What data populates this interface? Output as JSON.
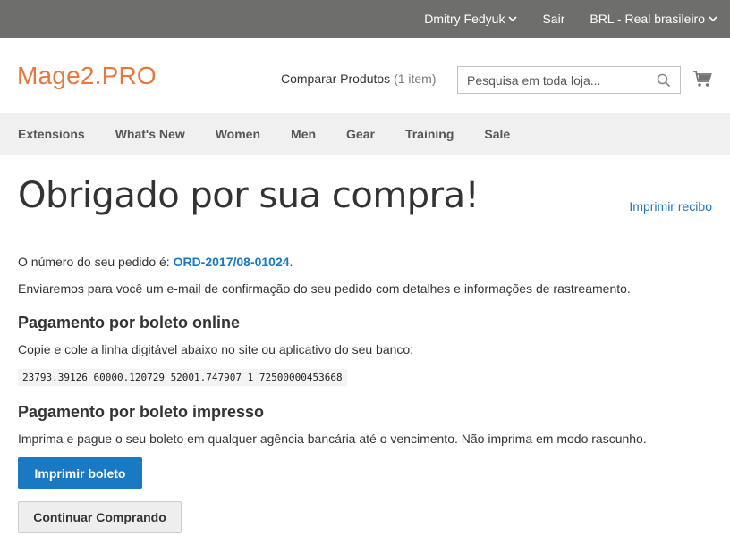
{
  "topbar": {
    "user": "Dmitry Fedyuk",
    "logout": "Sair",
    "currency": "BRL - Real brasileiro"
  },
  "header": {
    "logo": "Mage2.PRO",
    "compare_label": "Comparar Produtos",
    "compare_count": "(1 item)",
    "search_placeholder": "Pesquisa em toda loja...",
    "icons": [
      "search-icon",
      "cart-icon",
      "chevron-down-icon"
    ]
  },
  "nav": {
    "items": [
      "Extensions",
      "What's New",
      "Women",
      "Men",
      "Gear",
      "Training",
      "Sale"
    ]
  },
  "main": {
    "title": "Obrigado por sua compra!",
    "print_receipt": "Imprimir recibo",
    "order_prefix": "O número do seu pedido é: ",
    "order_number": "ORD-2017/08-01024",
    "order_suffix": ".",
    "email_notice": "Enviaremos para você um e-mail de confirmação do seu pedido com detalhes e informações de rastreamento.",
    "online_heading": "Pagamento por boleto online",
    "online_text": "Copie e cole a linha digitável abaixo no site ou aplicativo do seu banco:",
    "barcode_line": "23793.39126 60000.120729 52001.747907 1 72500000453668",
    "printed_heading": "Pagamento por boleto impresso",
    "printed_text": "Imprima e pague o seu boleto em qualquer agência bancária até o vencimento. Não imprima em modo rascunho.",
    "print_boleto_button": "Imprimir boleto",
    "continue_button": "Continuar Comprando"
  },
  "colors": {
    "topbar_bg": "#6e6e6c",
    "brand_orange": "#e8773c",
    "link_blue": "#1979c3",
    "nav_bg": "#f0f0f0"
  }
}
